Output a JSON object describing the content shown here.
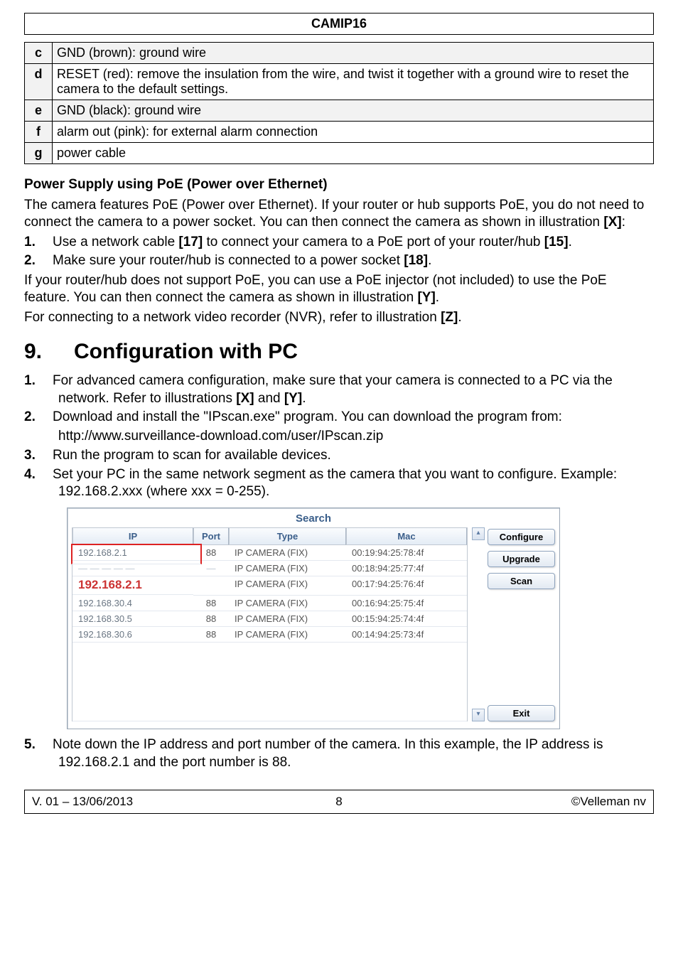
{
  "doc_title": "CAMIP16",
  "defs": [
    {
      "letter": "c",
      "text": "GND (brown): ground wire",
      "shaded": true
    },
    {
      "letter": "d",
      "text": "RESET (red): remove the insulation from the wire, and twist it together with a ground wire to reset the camera to the default settings.",
      "shaded": false
    },
    {
      "letter": "e",
      "text": "GND (black): ground wire",
      "shaded": true
    },
    {
      "letter": "f",
      "text": "alarm out (pink): for external alarm connection",
      "shaded": false
    },
    {
      "letter": "g",
      "text": "power cable",
      "shaded": false
    }
  ],
  "poe": {
    "heading": "Power Supply using PoE (Power over Ethernet)",
    "para1_a": "The camera features PoE (Power over Ethernet). If your router or hub supports PoE, you do not need to connect the camera to a power socket. You can then connect the camera as shown in illustration ",
    "para1_b": "[X]",
    "para1_c": ":",
    "li1_a": "Use a network cable ",
    "li1_b": "[17]",
    "li1_c": " to connect your camera to a PoE port of your router/hub ",
    "li1_d": "[15]",
    "li1_e": ".",
    "li2_a": "Make sure your router/hub is connected to a power socket ",
    "li2_b": "[18]",
    "li2_c": ".",
    "para2_a": "If your router/hub does not support PoE, you can use a PoE injector (not included) to use the PoE feature. You can then connect the camera as shown in illustration ",
    "para2_b": "[Y]",
    "para2_c": ".",
    "para3_a": "For connecting to a network video recorder (NVR), refer to illustration ",
    "para3_b": "[Z]",
    "para3_c": "."
  },
  "section": {
    "num": "9.",
    "title": "Configuration with PC",
    "li1_a": "For advanced camera configuration, make sure that your camera is connected to a PC via the network. Refer to illustrations ",
    "li1_b": "[X]",
    "li1_c": " and ",
    "li1_d": "[Y]",
    "li1_e": ".",
    "li2": "Download and install the \"IPscan.exe\" program. You can download the program from:",
    "url": "http://www.surveillance-download.com/user/IPscan.zip",
    "li3": "Run the program to scan for available devices.",
    "li4": "Set your PC in the same network segment as the camera that you want to configure. Example: 192.168.2.xxx (where xxx = 0-255).",
    "li5": "Note down the IP address and port number of the camera. In this example, the IP address is 192.168.2.1 and the port number is 88."
  },
  "search": {
    "title": "Search",
    "cols": {
      "ip": "IP",
      "port": "Port",
      "type": "Type",
      "mac": "Mac"
    },
    "btns": {
      "configure": "Configure",
      "upgrade": "Upgrade",
      "scan": "Scan",
      "exit": "Exit"
    },
    "highlight_ip": "192.168.2.1",
    "rows": [
      {
        "ip": "192.168.2.1",
        "port": "88",
        "type": "IP CAMERA (FIX)",
        "mac": "00:19:94:25:78:4f"
      },
      {
        "ip": "",
        "port": "",
        "type": "IP CAMERA (FIX)",
        "mac": "00:18:94:25:77:4f"
      },
      {
        "ip": "",
        "port": "",
        "type": "IP CAMERA (FIX)",
        "mac": "00:17:94:25:76:4f"
      },
      {
        "ip": "192.168.30.4",
        "port": "88",
        "type": "IP CAMERA (FIX)",
        "mac": "00:16:94:25:75:4f"
      },
      {
        "ip": "192.168.30.5",
        "port": "88",
        "type": "IP CAMERA (FIX)",
        "mac": "00:15:94:25:74:4f"
      },
      {
        "ip": "192.168.30.6",
        "port": "88",
        "type": "IP CAMERA (FIX)",
        "mac": "00:14:94:25:73:4f"
      }
    ]
  },
  "footer": {
    "left": "V. 01 – 13/06/2013",
    "center": "8",
    "right": "©Velleman nv"
  }
}
